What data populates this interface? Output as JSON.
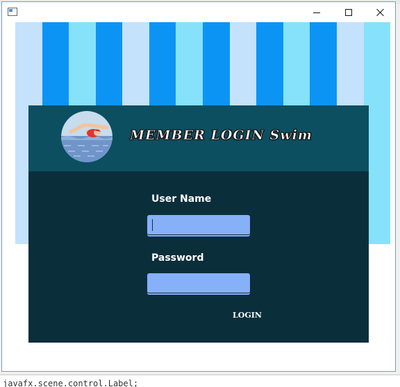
{
  "window": {
    "icon": "app-window-icon",
    "controls": {
      "minimize": "minimize-icon",
      "maximize": "maximize-icon",
      "close": "close-icon"
    }
  },
  "background": {
    "stripe_colors": [
      "#c4e2fb",
      "#0c94f5",
      "#86e2fa",
      "#0c94f5",
      "#c4e2fb",
      "#0c94f5",
      "#86e2fa",
      "#0c94f5",
      "#c4e2fb",
      "#0c94f5",
      "#86e2fa",
      "#0c94f5",
      "#c4e2fb",
      "#86e2fa"
    ]
  },
  "login": {
    "title": "MEMBER LOGIN Swim",
    "logo_icon": "swimmer-icon",
    "username_label": "User Name",
    "username_value": "",
    "password_label": "Password",
    "password_value": "",
    "login_button": "LOGIN"
  },
  "ide": {
    "status_text": "javafx.scene.control.Label;"
  },
  "colors": {
    "header": "#0c4f60",
    "panel": "#0b2e3b",
    "field": "#86b0f8"
  }
}
